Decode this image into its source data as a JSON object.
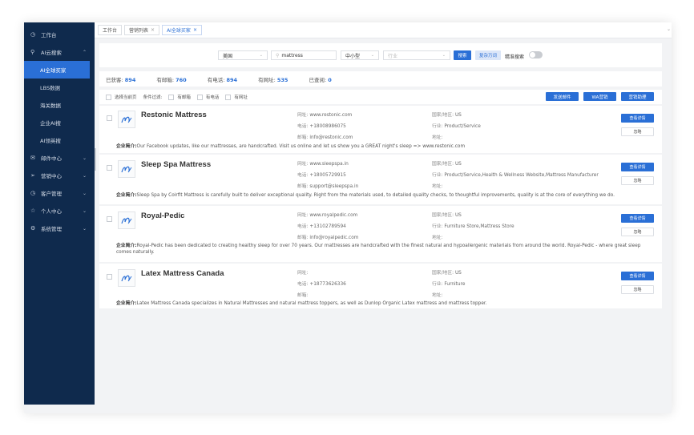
{
  "sidebar": {
    "items": [
      {
        "label": "工作台",
        "icon": "clock-icon",
        "chevron": ""
      },
      {
        "label": "AI云搜索",
        "icon": "search-icon",
        "chevron": "^"
      },
      {
        "label": "AI全球买家",
        "sub": true,
        "active": true
      },
      {
        "label": "LBS数据",
        "sub": true
      },
      {
        "label": "海关数据",
        "sub": true
      },
      {
        "label": "企业AI搜",
        "sub": true
      },
      {
        "label": "AI领英搜",
        "sub": true
      },
      {
        "label": "邮件中心",
        "icon": "mail-icon",
        "chevron": "v"
      },
      {
        "label": "营销中心",
        "icon": "send-icon",
        "chevron": "v"
      },
      {
        "label": "客户管理",
        "icon": "clock-icon",
        "chevron": "v"
      },
      {
        "label": "个人中心",
        "icon": "star-icon",
        "chevron": "v"
      },
      {
        "label": "系统管理",
        "icon": "gear-icon",
        "chevron": "v"
      }
    ]
  },
  "tabs": [
    {
      "label": "工作台",
      "closable": false,
      "active": false
    },
    {
      "label": "营销列表",
      "closable": true,
      "active": false
    },
    {
      "label": "AI全球买家",
      "closable": true,
      "active": true
    }
  ],
  "search": {
    "country": "美国",
    "keyword": "mattress",
    "size": "中小型",
    "industry_placeholder": "行业",
    "search_button": "搜索",
    "batch_button": "复杂万词",
    "precise_label": "精准搜索"
  },
  "stats": [
    {
      "label": "已获客:",
      "value": "894"
    },
    {
      "label": "有邮箱:",
      "value": "760"
    },
    {
      "label": "有电话:",
      "value": "894"
    },
    {
      "label": "有网址:",
      "value": "535"
    },
    {
      "label": "已查阅:",
      "value": "0"
    }
  ],
  "filters": {
    "select_page": "选择当前页",
    "condition": "条件过滤:",
    "options": [
      "有邮箱",
      "有电话",
      "有网址"
    ],
    "actions": [
      "发送邮件",
      "WA营销",
      "营销助理"
    ]
  },
  "labels": {
    "website": "网址:",
    "phone": "电话:",
    "email": "邮箱:",
    "country": "国家/地区:",
    "industry": "行业:",
    "address": "地址:",
    "intro": "企业简介:",
    "detail_button": "查看详情",
    "ignore_button": "忽略"
  },
  "companies": [
    {
      "name": "Restonic Mattress",
      "website": "www.restonic.com",
      "phone": "+18008986075",
      "email": "info@restonic.com",
      "country": "US",
      "industry": "Product/Service",
      "address": "",
      "intro": "Our Facebook updates, like our mattresses, are handcrafted. Visit us online and let us show you a GREAT night's sleep => www.restonic.com"
    },
    {
      "name": "Sleep Spa Mattress",
      "website": "www.sleepspa.in",
      "phone": "+18005729915",
      "email": "support@sleepspa.in",
      "country": "US",
      "industry": "Product/Service,Health & Wellness Website,Mattress Manufacturer",
      "address": "",
      "intro": "Sleep Spa by Coirfit Mattress is carefully built to deliver exceptional quality. Right from the materials used, to detailed quality checks, to thoughtful improvements, quality is at the core of everything we do."
    },
    {
      "name": "Royal-Pedic",
      "website": "www.royalpedic.com",
      "phone": "+13102789594",
      "email": "info@royalpedic.com",
      "country": "US",
      "industry": "Furniture Store,Mattress Store",
      "address": "",
      "intro": "Royal-Pedic has been dedicated to creating healthy sleep for over 70 years. Our mattresses are handcrafted with the finest natural and hypoallergenic materials from around the world. Royal-Pedic - where great sleep comes naturally."
    },
    {
      "name": "Latex Mattress Canada",
      "website": "",
      "phone": "+18773626336",
      "email": "",
      "country": "US",
      "industry": "Furniture",
      "address": "",
      "intro": "Latex Mattress Canada specializes in Natural Mattresses and natural mattress toppers, as well as Dunlop Organic Latex mattress and mattress topper."
    }
  ],
  "colors": {
    "sidebar_bg": "#0f2a4d",
    "accent": "#2a6fd6"
  }
}
